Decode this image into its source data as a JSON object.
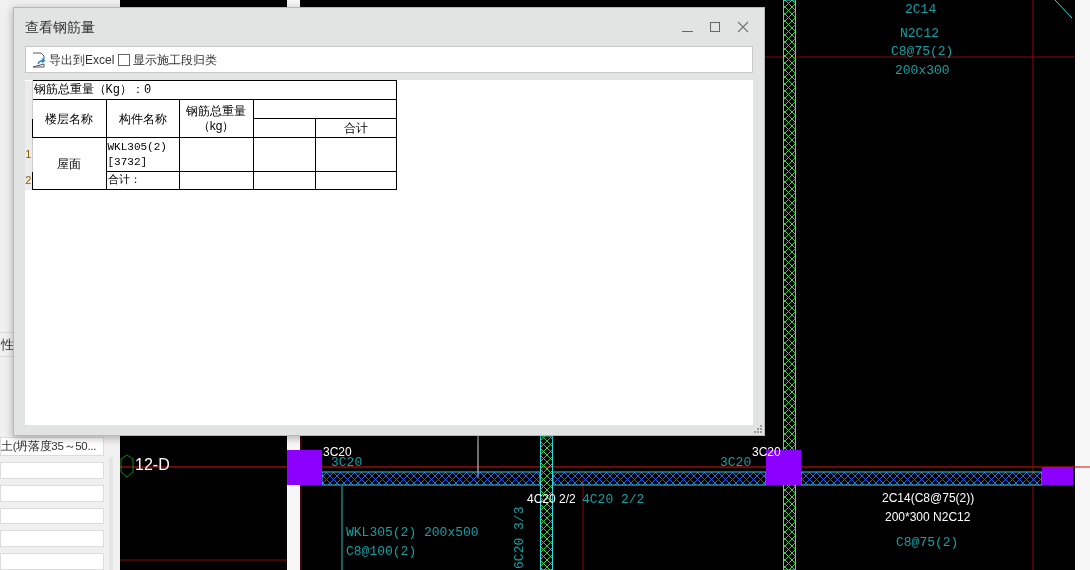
{
  "left_panel": {
    "property_label": "性",
    "material_field": "土(坍落度35～50..."
  },
  "drawing": {
    "axis_label": "12-D",
    "labels": [
      {
        "text": "2C14",
        "kind": "cad"
      },
      {
        "text": "N2C12",
        "kind": "cad"
      },
      {
        "text": "C8@75(2)",
        "kind": "cad"
      },
      {
        "text": "200x300",
        "kind": "cad"
      },
      {
        "text": "3C20",
        "kind": "overlay"
      },
      {
        "text": "3C20",
        "kind": "cad"
      },
      {
        "text": "3C20",
        "kind": "cad"
      },
      {
        "text": "3C20",
        "kind": "overlay"
      },
      {
        "text": "4C20 2/2",
        "kind": "overlay"
      },
      {
        "text": "4C20 2/2",
        "kind": "cad"
      },
      {
        "text": "WKL305(2) 200x500",
        "kind": "cad"
      },
      {
        "text": "C8@100(2)",
        "kind": "cad"
      },
      {
        "text": "6C20 3/3",
        "kind": "cad"
      },
      {
        "text": "2C14(C8@75(2))",
        "kind": "overlay"
      },
      {
        "text": "200*300 N2C12",
        "kind": "overlay"
      },
      {
        "text": "C8@75(2)",
        "kind": "cad"
      }
    ]
  },
  "window": {
    "title": "查看钢筋量"
  },
  "toolbar": {
    "export_button": "导出到Excel",
    "checkbox": {
      "label": "显示施工段归类",
      "checked": false
    }
  },
  "table": {
    "summary": "钢筋总重量（Kg）：0",
    "columns": [
      "楼层名称",
      "构件名称",
      "钢筋总重量（kg）"
    ],
    "subheader": "合计",
    "floor": "屋面",
    "rows": [
      {
        "number": "1",
        "component": "WKL305(2)[3732]"
      },
      {
        "number": "2",
        "component": "合计："
      }
    ]
  }
}
